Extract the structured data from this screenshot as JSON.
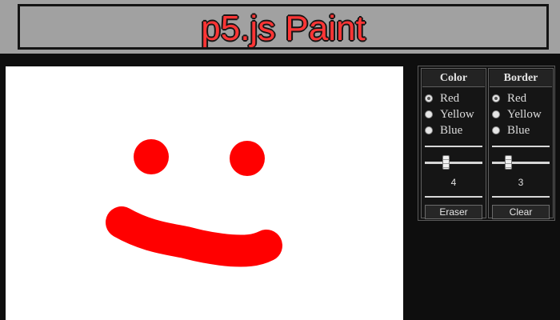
{
  "header": {
    "title": "p5.js Paint"
  },
  "drawing": {
    "stroke_color": "#ff0000",
    "shapes": [
      "left-eye",
      "right-eye",
      "mouth-stroke"
    ]
  },
  "panel": {
    "color_column": {
      "title": "Color",
      "options": [
        {
          "label": "Red",
          "selected": true
        },
        {
          "label": "Yellow",
          "selected": false
        },
        {
          "label": "Blue",
          "selected": false
        }
      ],
      "slider_value": "4",
      "slider_fraction": 0.35,
      "button_label": "Eraser"
    },
    "border_column": {
      "title": "Border",
      "options": [
        {
          "label": "Red",
          "selected": true
        },
        {
          "label": "Yellow",
          "selected": false
        },
        {
          "label": "Blue",
          "selected": false
        }
      ],
      "slider_value": "3",
      "slider_fraction": 0.25,
      "button_label": "Clear"
    }
  },
  "colors": {
    "header_bg": "#a1a1a1",
    "title_fill": "#ff3535",
    "page_bg": "#0e0e0e",
    "canvas_bg": "#ffffff",
    "paint_red": "#ff0000"
  }
}
